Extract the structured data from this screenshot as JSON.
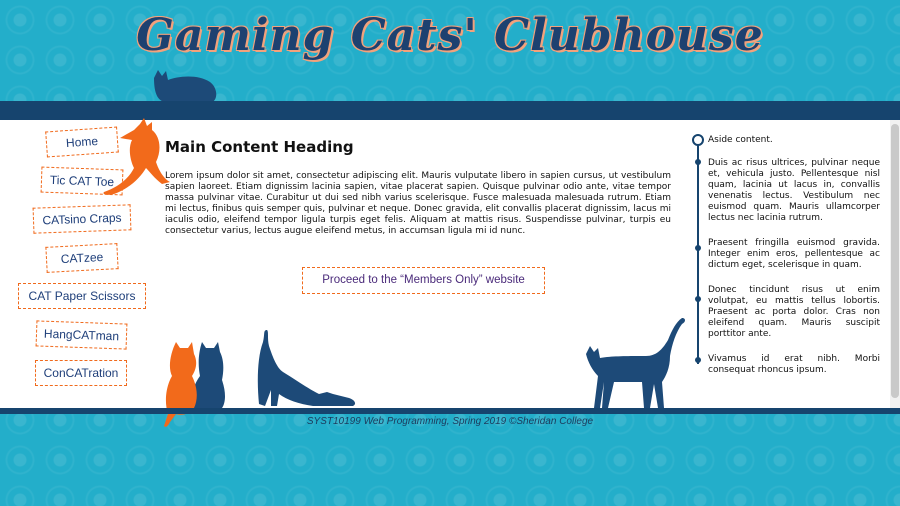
{
  "header": {
    "site_title": "Gaming Cats' Clubhouse"
  },
  "nav": {
    "items": [
      {
        "label": "Home"
      },
      {
        "label": "Tic CAT Toe"
      },
      {
        "label": "CATsino Craps"
      },
      {
        "label": "CATzee"
      },
      {
        "label": "CAT Paper Scissors"
      },
      {
        "label": "HangCATman"
      },
      {
        "label": "ConCATration"
      }
    ]
  },
  "main": {
    "heading": "Main Content Heading",
    "body": "Lorem ipsum dolor sit amet, consectetur adipiscing elit. Mauris vulputate libero in sapien cursus, ut vestibulum sapien laoreet. Etiam dignissim lacinia sapien, vitae placerat sapien. Quisque pulvinar odio ante, vitae tempor massa pulvinar vitae. Curabitur ut dui sed nibh varius scelerisque. Fusce malesuada malesuada rutrum. Etiam mi lectus, finibus quis semper quis, pulvinar et neque. Donec gravida, elit convallis placerat dignissim, lacus mi iaculis odio, eleifend tempor ligula turpis eget felis. Aliquam at mattis risus. Suspendisse pulvinar, turpis eu consectetur varius, lectus augue eleifend metus, in accumsan ligula mi id nunc.",
    "members_button": "Proceed to the “Members Only” website"
  },
  "aside": {
    "paragraphs": [
      "Aside content.",
      "Duis ac risus ultrices, pulvinar neque et, vehicula justo. Pellentesque nisl quam, lacinia ut lacus in, convallis venenatis lectus. Vestibulum nec euismod quam. Mauris ullamcorper lectus nec lacinia rutrum.",
      "Praesent fringilla euismod gravida. Integer enim eros, pellentesque ac dictum eget, scelerisque in quam.",
      "Donec tincidunt risus ut enim volutpat, eu mattis tellus lobortis. Praesent ac porta dolor. Cras non eleifend quam. Mauris suscipit porttitor ante.",
      "Vivamus id erat nibh. Morbi consequat rhoncus ipsum."
    ]
  },
  "footer": {
    "text": "SYST10199 Web Programming, Spring 2019 ©Sheridan College"
  },
  "colors": {
    "background": "#23aeca",
    "navy": "#16446e",
    "accent_orange": "#f06a1c"
  }
}
